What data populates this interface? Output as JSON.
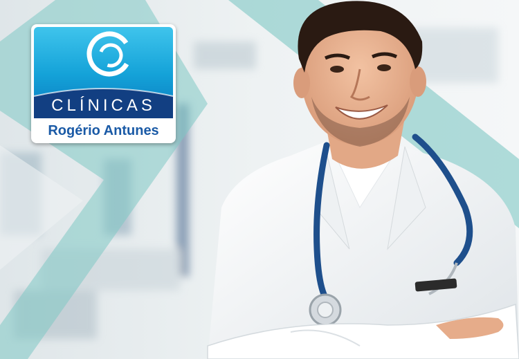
{
  "logo": {
    "title": "CLÍNICAS",
    "subtitle": "Rogério Antunes",
    "icon": "swirl-logo-icon",
    "colors": {
      "sky": "#14a2d8",
      "navy": "#123f82",
      "subtitle": "#1a5aa6"
    }
  },
  "photo": {
    "subject": "smiling-doctor-with-stethoscope",
    "accent_color": "#7fc8c4"
  }
}
